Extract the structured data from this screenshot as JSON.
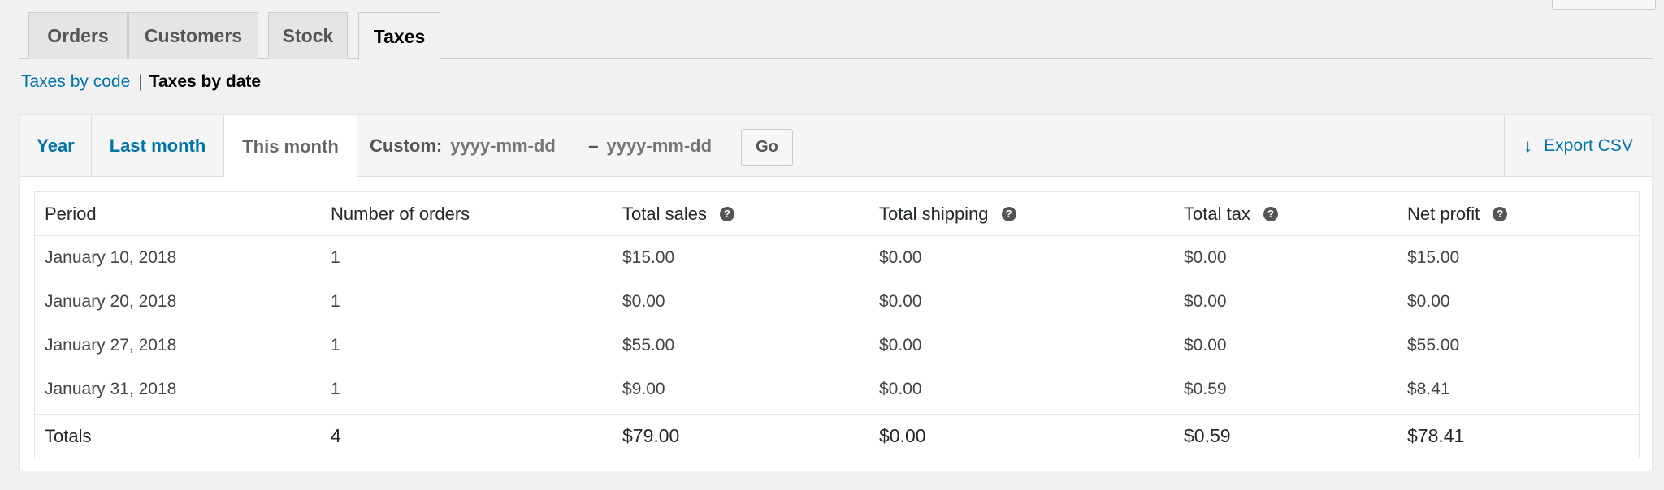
{
  "nav_tabs": [
    {
      "label": "Orders"
    },
    {
      "label": "Customers"
    },
    {
      "label": "Stock"
    },
    {
      "label": "Taxes",
      "active": true
    }
  ],
  "subsubsub": {
    "link": "Taxes by code",
    "separator": "|",
    "current": "Taxes by date"
  },
  "range": {
    "tabs": [
      {
        "label": "Year"
      },
      {
        "label": "Last month"
      },
      {
        "label": "This month",
        "active": true
      }
    ],
    "custom_label": "Custom:",
    "start_placeholder": "yyyy-mm-dd",
    "dash": "–",
    "end_placeholder": "yyyy-mm-dd",
    "go_label": "Go",
    "export_label": "Export CSV",
    "export_icon": "arrow-down-icon"
  },
  "table": {
    "headers": [
      "Period",
      "Number of orders",
      "Total sales",
      "Total shipping",
      "Total tax",
      "Net profit"
    ],
    "help_icon": "?",
    "rows": [
      [
        "January 10, 2018",
        "1",
        "$15.00",
        "$0.00",
        "$0.00",
        "$15.00"
      ],
      [
        "January 20, 2018",
        "1",
        "$0.00",
        "$0.00",
        "$0.00",
        "$0.00"
      ],
      [
        "January 27, 2018",
        "1",
        "$55.00",
        "$0.00",
        "$0.00",
        "$55.00"
      ],
      [
        "January 31, 2018",
        "1",
        "$9.00",
        "$0.00",
        "$0.59",
        "$8.41"
      ]
    ],
    "totals": [
      "Totals",
      "4",
      "$79.00",
      "$0.00",
      "$0.59",
      "$78.41"
    ]
  },
  "colors": {
    "link": "#0073aa",
    "background": "#f1f1f1",
    "panel": "#ffffff",
    "border": "#e5e5e5"
  }
}
